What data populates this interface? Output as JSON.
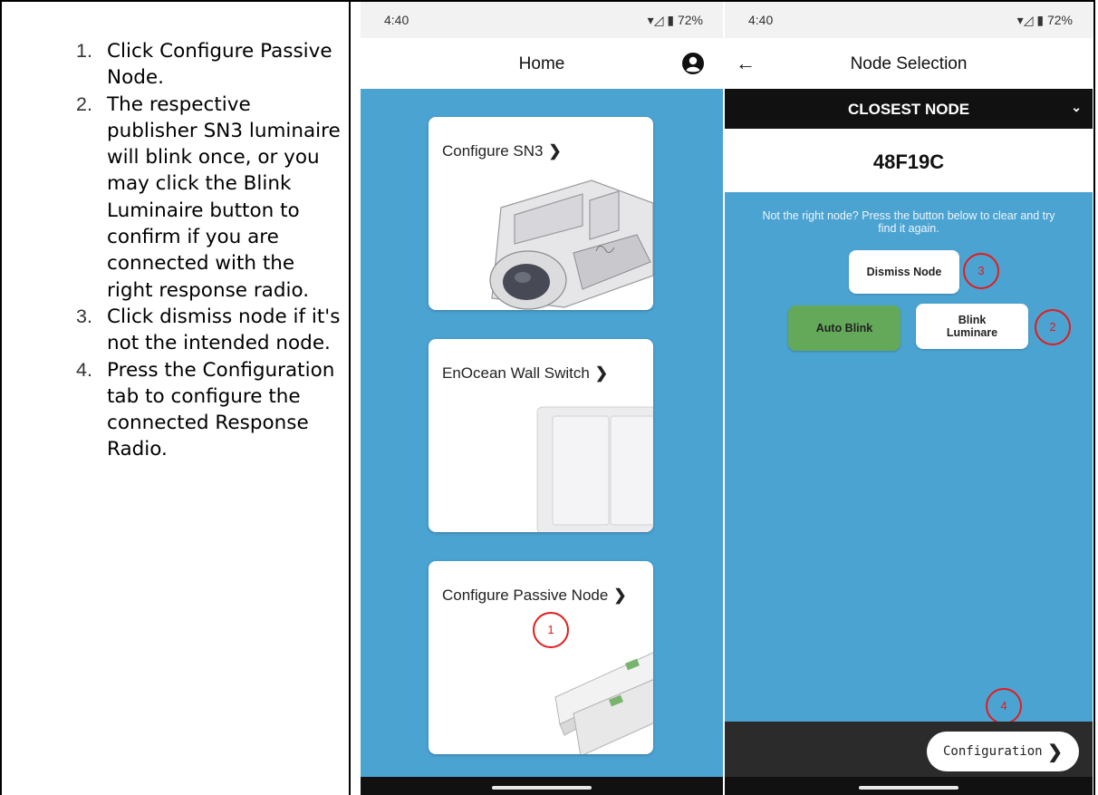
{
  "instructions": {
    "steps": [
      {
        "num": "1.",
        "text": "Click Configure Passive Node."
      },
      {
        "num": "2.",
        "text": "The respective publisher SN3 luminaire will blink once, or you may click the Blink Luminaire button to confirm if you are connected with the right response radio."
      },
      {
        "num": "3.",
        "text": "Click dismiss node if it's not the intended node."
      },
      {
        "num": "4.",
        "text": "Press the Configuration tab to configure the connected Response Radio."
      }
    ]
  },
  "phone_home": {
    "status": {
      "time": "4:40",
      "battery": "72%"
    },
    "title": "Home",
    "cards": [
      {
        "label": "Configure SN3"
      },
      {
        "label": "EnOcean Wall Switch"
      },
      {
        "label": "Configure Passive Node"
      }
    ],
    "marker": "1"
  },
  "phone_node": {
    "status": {
      "time": "4:40",
      "battery": "72%"
    },
    "title": "Node Selection",
    "dropdown": "CLOSEST NODE",
    "node_id": "48F19C",
    "hint": "Not the right node? Press the button below to clear and try find it again.",
    "dismiss_label": "Dismiss Node",
    "auto_blink_label": "Auto Blink",
    "blink_label_1": "Blink",
    "blink_label_2": "Luminare",
    "config_label": "Configuration",
    "markers": {
      "m2": "2",
      "m3": "3",
      "m4": "4"
    }
  },
  "colors": {
    "accent_blue": "#4ba3d2",
    "auto_blink_green": "#64a95a",
    "marker_red": "#e31c1c"
  }
}
